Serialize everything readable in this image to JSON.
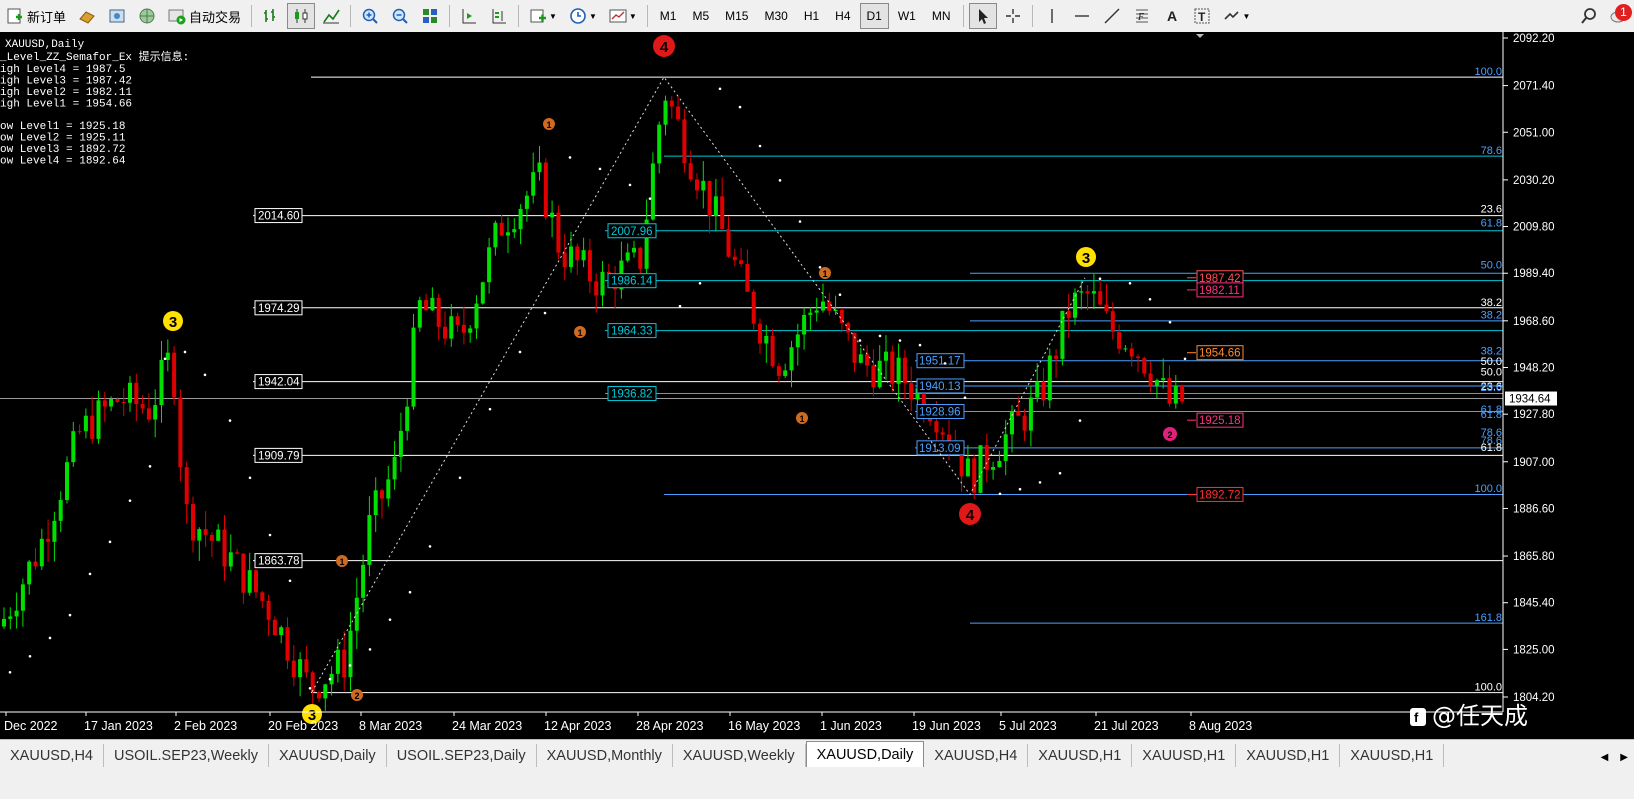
{
  "toolbar": {
    "new_order": "新订单",
    "auto_trade": "自动交易",
    "timeframes": [
      "M1",
      "M5",
      "M15",
      "M30",
      "H1",
      "H4",
      "D1",
      "W1",
      "MN"
    ],
    "active_timeframe": "D1",
    "notification_count": "1"
  },
  "chart": {
    "symbol_title": "XAUUSD,Daily",
    "indicator_title": "_Level_ZZ_Semafor_Ex 提示信息:",
    "high_levels": [
      "igh Level4 = 1987.5",
      "igh Level3 = 1987.42",
      "igh Level2 = 1982.11",
      "igh Level1 = 1954.66"
    ],
    "low_levels": [
      "ow Level1 = 1925.18",
      "ow Level2 = 1925.11",
      "ow Level3 = 1892.72",
      "ow Level4 = 1892.64"
    ],
    "current_price": "1934.64",
    "watermark": "@任天成",
    "price_axis": [
      "2092.20",
      "2071.40",
      "2051.00",
      "2030.20",
      "2009.80",
      "1989.40",
      "1968.60",
      "1948.20",
      "1927.80",
      "1907.00",
      "1886.60",
      "1865.80",
      "1845.40",
      "1825.00",
      "1804.20"
    ],
    "date_axis": [
      "Dec 2022",
      "17 Jan 2023",
      "2 Feb 2023",
      "20 Feb 2023",
      "8 Mar 2023",
      "24 Mar 2023",
      "12 Apr 2023",
      "28 Apr 2023",
      "16 May 2023",
      "1 Jun 2023",
      "19 Jun 2023",
      "5 Jul 2023",
      "21 Jul 2023",
      "8 Aug 2023"
    ],
    "left_level_boxes": [
      "2014.60",
      "1974.29",
      "1942.04",
      "1909.79",
      "1863.78"
    ],
    "mid_level_boxes": [
      "2007.96",
      "1986.14",
      "1964.33",
      "1936.82"
    ],
    "right_level_boxes": [
      "1951.17",
      "1940.13",
      "1928.96",
      "1913.09"
    ],
    "semafor_boxes": [
      "1987.42",
      "1982.11",
      "1954.66",
      "1925.18",
      "1892.72"
    ],
    "fib_labels_left": [
      "100.0",
      "78.6",
      "23.6",
      "61.8",
      "38.2",
      "50.0",
      "23.6",
      "61.8",
      "78.6",
      "100.0"
    ],
    "fib_labels_right": [
      "50.0",
      "38.2",
      "38.2",
      "50.0",
      "23.6",
      "61.8",
      "78.6",
      "61.8",
      "100.0",
      "161.8"
    ],
    "semafor_markers": [
      "4",
      "3",
      "3",
      "4",
      "3",
      "2",
      "1",
      "1",
      "1",
      "1",
      "1",
      "2"
    ]
  },
  "tabs": [
    "XAUUSD,H4",
    "USOIL.SEP23,Weekly",
    "XAUUSD,Daily",
    "USOIL.SEP23,Daily",
    "XAUUSD,Monthly",
    "XAUUSD,Weekly",
    "XAUUSD,Daily",
    "XAUUSD,H4",
    "XAUUSD,H1",
    "XAUUSD,H1",
    "XAUUSD,H1",
    "XAUUSD,H1"
  ],
  "active_tab_index": 6,
  "colors": {
    "bull": "#00e000",
    "bear": "#e00000",
    "fib": "#4aa0ff",
    "cyan": "#00c8d8"
  }
}
